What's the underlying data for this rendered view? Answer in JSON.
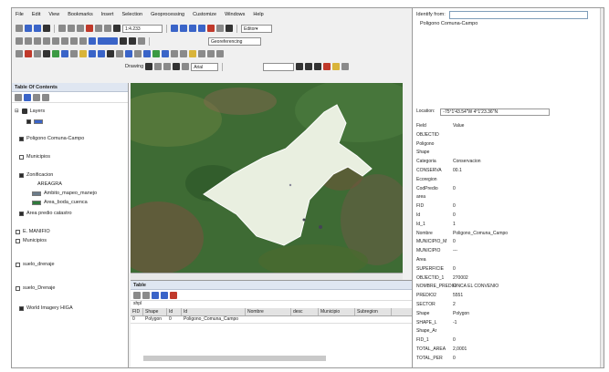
{
  "menu": [
    "File",
    "Edit",
    "View",
    "Bookmarks",
    "Insert",
    "Selection",
    "Geoprocessing",
    "Customize",
    "Windows",
    "Help"
  ],
  "toolbar": {
    "scale_value": "1:4.233",
    "georeferencing_combo": "Georeferencing",
    "drawing_label": "Drawing",
    "font_combo": "Arial"
  },
  "toc": {
    "title": "Table Of Contents",
    "root": "Layers",
    "layers": [
      {
        "name": "",
        "checked": true,
        "indent": 0
      },
      {
        "name": "Poligono Comuna-Campo",
        "checked": true,
        "indent": 0
      },
      {
        "name": "Municipios",
        "checked": false,
        "indent": 0
      },
      {
        "name": "Zonificacion",
        "checked": true,
        "indent": 0
      },
      {
        "name": "AREAGRA",
        "checked": false,
        "indent": 2
      },
      {
        "name": "Ambito_mapeo_manejo",
        "checked": false,
        "indent": 1
      },
      {
        "name": "Area_boda_cuenca",
        "checked": false,
        "indent": 1
      },
      {
        "name": "Area predio catastro",
        "checked": true,
        "indent": 0
      },
      {
        "name": "E. MANIFIO",
        "checked": false,
        "indent": 0
      },
      {
        "name": "Municipios",
        "checked": false,
        "indent": 0
      },
      {
        "name": "suelo_drenaje",
        "checked": false,
        "indent": 0
      },
      {
        "name": "suelo_Drenaje",
        "checked": false,
        "indent": 0
      },
      {
        "name": "World Imagery HIGA",
        "checked": true,
        "indent": 0
      }
    ]
  },
  "table": {
    "title": "Table",
    "tab": "shpl",
    "columns": [
      "FID",
      "Shape",
      "Id",
      "Id",
      "Nombre",
      "desc",
      "Municipio",
      "Subregion"
    ],
    "row": [
      "0",
      "Polygon",
      "0",
      "Poligono_Comuna_Campo",
      "",
      "",
      "",
      ""
    ]
  },
  "identify": {
    "title": "Identify from:",
    "tree_item": "Poligono Comuna-Campo",
    "location_label": "Location:",
    "location_value": "-75°1'43.54\"W 4°1'23.36\"N",
    "attributes": [
      {
        "field": "Field",
        "value": "Value"
      },
      {
        "field": "OBJECTID",
        "value": ""
      },
      {
        "field": "Poligono",
        "value": ""
      },
      {
        "field": "Shape",
        "value": ""
      },
      {
        "field": "Categoria",
        "value": "Conservacion"
      },
      {
        "field": "CONSERVA",
        "value": "00.1"
      },
      {
        "field": "Ecoregion",
        "value": ""
      },
      {
        "field": "CodPredio",
        "value": "0"
      },
      {
        "field": "area",
        "value": ""
      },
      {
        "field": "FID",
        "value": "0"
      },
      {
        "field": "Id",
        "value": "0"
      },
      {
        "field": "Id_1",
        "value": "1"
      },
      {
        "field": "Nombre",
        "value": "Poligono_Comuna_Campo"
      },
      {
        "field": "MUNICIPIO_M",
        "value": "0"
      },
      {
        "field": "MUNICIPIO",
        "value": "---"
      },
      {
        "field": "Area",
        "value": ""
      },
      {
        "field": "SUPERFICIE",
        "value": "0"
      },
      {
        "field": "OBJECTID_1",
        "value": "270002"
      },
      {
        "field": "NOMBRE_PREDIO",
        "value": "FINCA EL CONVENIO"
      },
      {
        "field": "PREDIO2",
        "value": "5551"
      },
      {
        "field": "SECTOR",
        "value": "2"
      },
      {
        "field": "Shape",
        "value": "Polygon"
      },
      {
        "field": "SHAPE_L",
        "value": "-1"
      },
      {
        "field": "Shape_Ar",
        "value": ""
      },
      {
        "field": "FID_1",
        "value": "0"
      },
      {
        "field": "TOTAL_AREA",
        "value": "2,0001"
      },
      {
        "field": "TOTAL_PER",
        "value": "0"
      }
    ]
  }
}
